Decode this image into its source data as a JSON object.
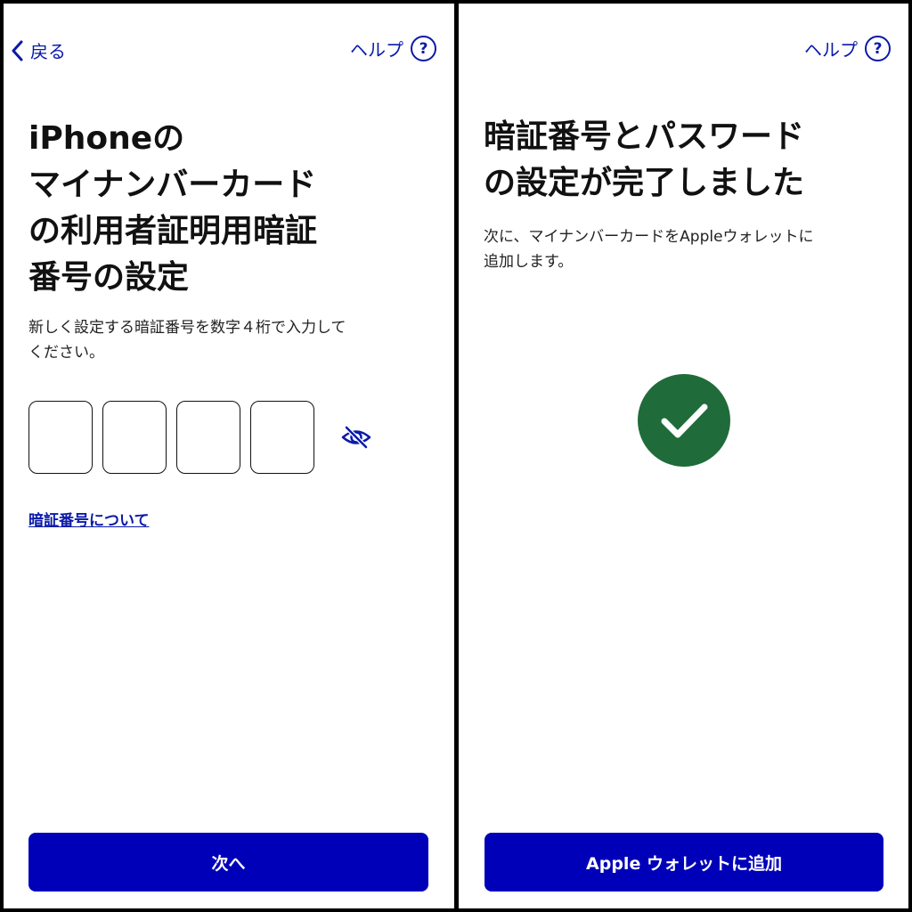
{
  "left_screen": {
    "back_label": "戻る",
    "help_label": "ヘルプ",
    "help_icon_glyph": "?",
    "title": "iPhoneの\nマイナンバーカード\nの利用者証明用暗証\n番号の設定",
    "description": "新しく設定する暗証番号を数字４桁で入力して\nください。",
    "pin_digits": [
      "",
      "",
      "",
      ""
    ],
    "visibility_icon": "eye-slash-icon",
    "link_label": "暗証番号について",
    "button_label": "次へ"
  },
  "right_screen": {
    "help_label": "ヘルプ",
    "help_icon_glyph": "?",
    "title": "暗証番号とパスワード\nの設定が完了しました",
    "description": "次に、マイナンバーカードをAppleウォレットに\n追加します。",
    "status_icon": "checkmark-circle-icon",
    "button_label": "Apple ウォレットに追加"
  },
  "colors": {
    "accent": "#0a1aa8",
    "button": "#0000b8",
    "success": "#1f6b3a"
  }
}
